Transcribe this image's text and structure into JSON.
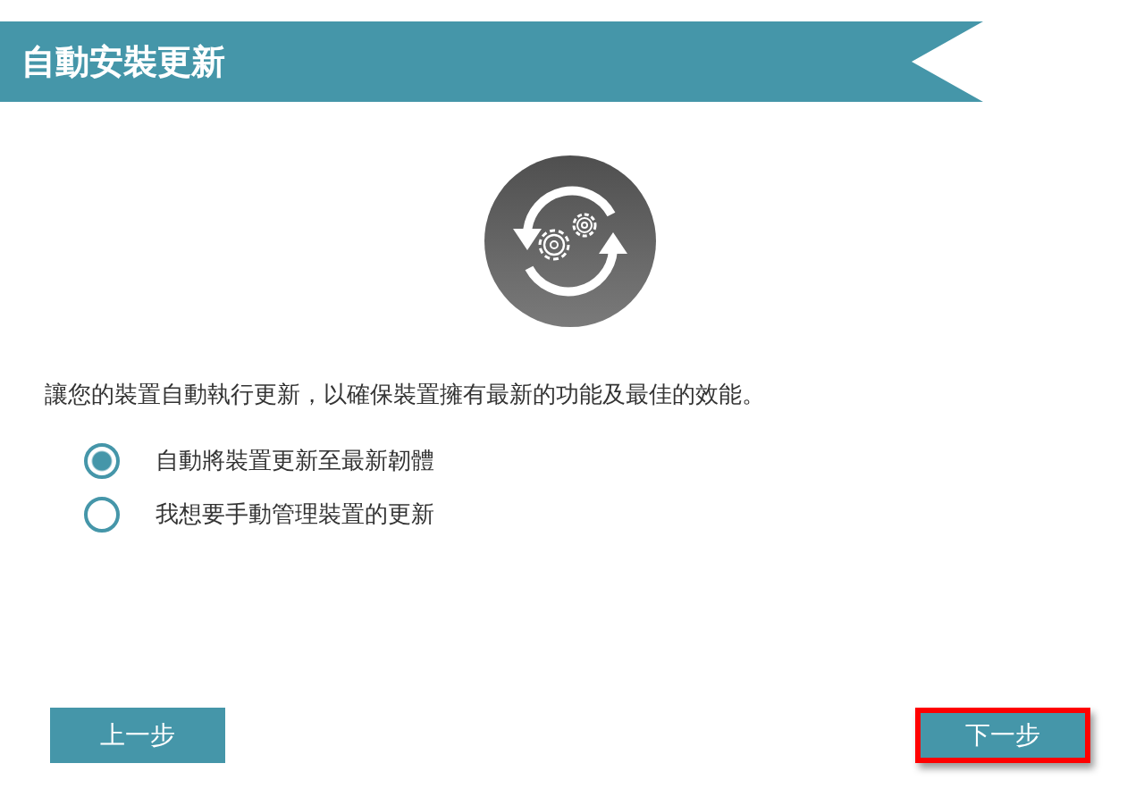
{
  "header": {
    "title": "自動安裝更新"
  },
  "description": "讓您的裝置自動執行更新，以確保裝置擁有最新的功能及最佳的效能。",
  "options": [
    {
      "label": "自動將裝置更新至最新韌體",
      "selected": true
    },
    {
      "label": "我想要手動管理裝置的更新",
      "selected": false
    }
  ],
  "buttons": [
    {
      "label": "上一步",
      "highlighted": false
    },
    {
      "label": "下一步",
      "highlighted": true
    }
  ]
}
